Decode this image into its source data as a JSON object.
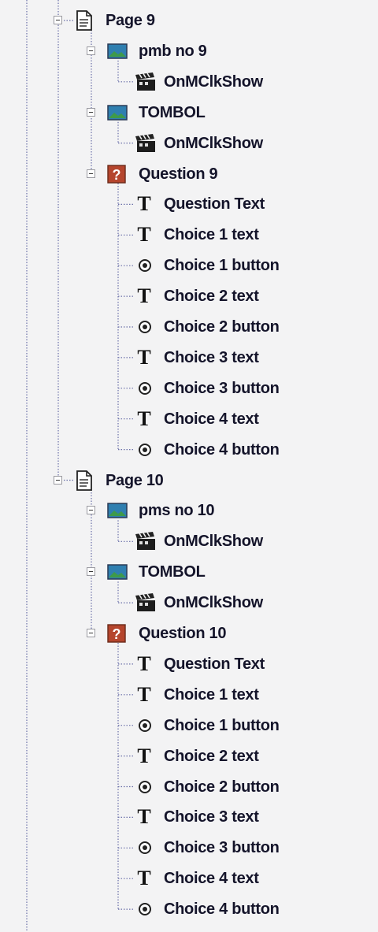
{
  "tree": [
    {
      "type": "page",
      "label": "Page 9",
      "level": 0,
      "expanded": true
    },
    {
      "type": "image",
      "label": "pmb no 9",
      "level": 1,
      "expanded": true
    },
    {
      "type": "action",
      "label": "OnMClkShow",
      "level": 2
    },
    {
      "type": "image",
      "label": "TOMBOL",
      "level": 1,
      "expanded": true
    },
    {
      "type": "action",
      "label": "OnMClkShow",
      "level": 2
    },
    {
      "type": "question",
      "label": "Question 9",
      "level": 1,
      "expanded": true
    },
    {
      "type": "text",
      "label": "Question Text",
      "level": 2
    },
    {
      "type": "text",
      "label": "Choice 1 text",
      "level": 2
    },
    {
      "type": "radio",
      "label": "Choice 1 button",
      "level": 2
    },
    {
      "type": "text",
      "label": "Choice 2 text",
      "level": 2
    },
    {
      "type": "radio",
      "label": "Choice 2 button",
      "level": 2
    },
    {
      "type": "text",
      "label": "Choice 3 text",
      "level": 2
    },
    {
      "type": "radio",
      "label": "Choice 3 button",
      "level": 2
    },
    {
      "type": "text",
      "label": "Choice 4 text",
      "level": 2
    },
    {
      "type": "radio",
      "label": "Choice 4 button",
      "level": 2
    },
    {
      "type": "page",
      "label": "Page 10",
      "level": 0,
      "expanded": true
    },
    {
      "type": "image",
      "label": "pms no 10",
      "level": 1,
      "expanded": true
    },
    {
      "type": "action",
      "label": "OnMClkShow",
      "level": 2
    },
    {
      "type": "image",
      "label": "TOMBOL",
      "level": 1,
      "expanded": true
    },
    {
      "type": "action",
      "label": "OnMClkShow",
      "level": 2
    },
    {
      "type": "question",
      "label": "Question 10",
      "level": 1,
      "expanded": true
    },
    {
      "type": "text",
      "label": "Question Text",
      "level": 2
    },
    {
      "type": "text",
      "label": "Choice 1 text",
      "level": 2
    },
    {
      "type": "radio",
      "label": "Choice 1 button",
      "level": 2
    },
    {
      "type": "text",
      "label": "Choice 2 text",
      "level": 2
    },
    {
      "type": "radio",
      "label": "Choice 2 button",
      "level": 2
    },
    {
      "type": "text",
      "label": "Choice 3 text",
      "level": 2
    },
    {
      "type": "radio",
      "label": "Choice 3 button",
      "level": 2
    },
    {
      "type": "text",
      "label": "Choice 4 text",
      "level": 2
    },
    {
      "type": "radio",
      "label": "Choice 4 button",
      "level": 2
    }
  ],
  "colors": {
    "background": "#f3f3f4",
    "dotted_line": "#6a6fa8",
    "image_icon_sky": "#2f7fb0",
    "image_icon_land": "#3e9a4a",
    "question_icon": "#b5452d"
  },
  "icons": {
    "page": "page-icon",
    "image": "image-icon",
    "action": "clapperboard-icon",
    "question": "question-icon",
    "text": "text-t-icon",
    "radio": "radio-button-icon",
    "toggle": "collapse-toggle"
  }
}
